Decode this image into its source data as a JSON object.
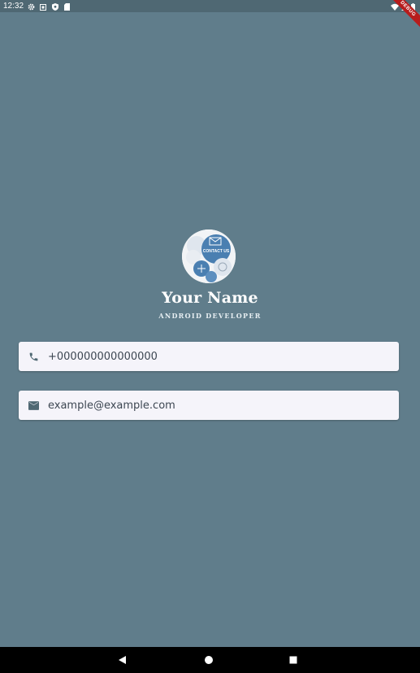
{
  "status_bar": {
    "time": "12:32",
    "left_icons": [
      "settings-icon",
      "notification-icon",
      "shield-icon",
      "sd-card-icon"
    ],
    "right_icons": [
      "wifi-icon",
      "signal-icon",
      "battery-icon"
    ],
    "debug_banner": "DEBUG"
  },
  "profile": {
    "avatar_icon": "contact-us-icon",
    "avatar_text": "CONTACT US",
    "name": "Your Name",
    "role": "ANDROID DEVELOPER"
  },
  "contacts": {
    "phone": {
      "icon": "phone-icon",
      "value": "+000000000000000"
    },
    "email": {
      "icon": "email-icon",
      "value": "example@example.com"
    }
  },
  "nav_bar": {
    "buttons": [
      "back-icon",
      "home-icon",
      "recents-icon"
    ]
  },
  "colors": {
    "background": "#607d8b",
    "card": "#f5f4fa",
    "text": "#3d4752",
    "white": "#ffffff"
  }
}
